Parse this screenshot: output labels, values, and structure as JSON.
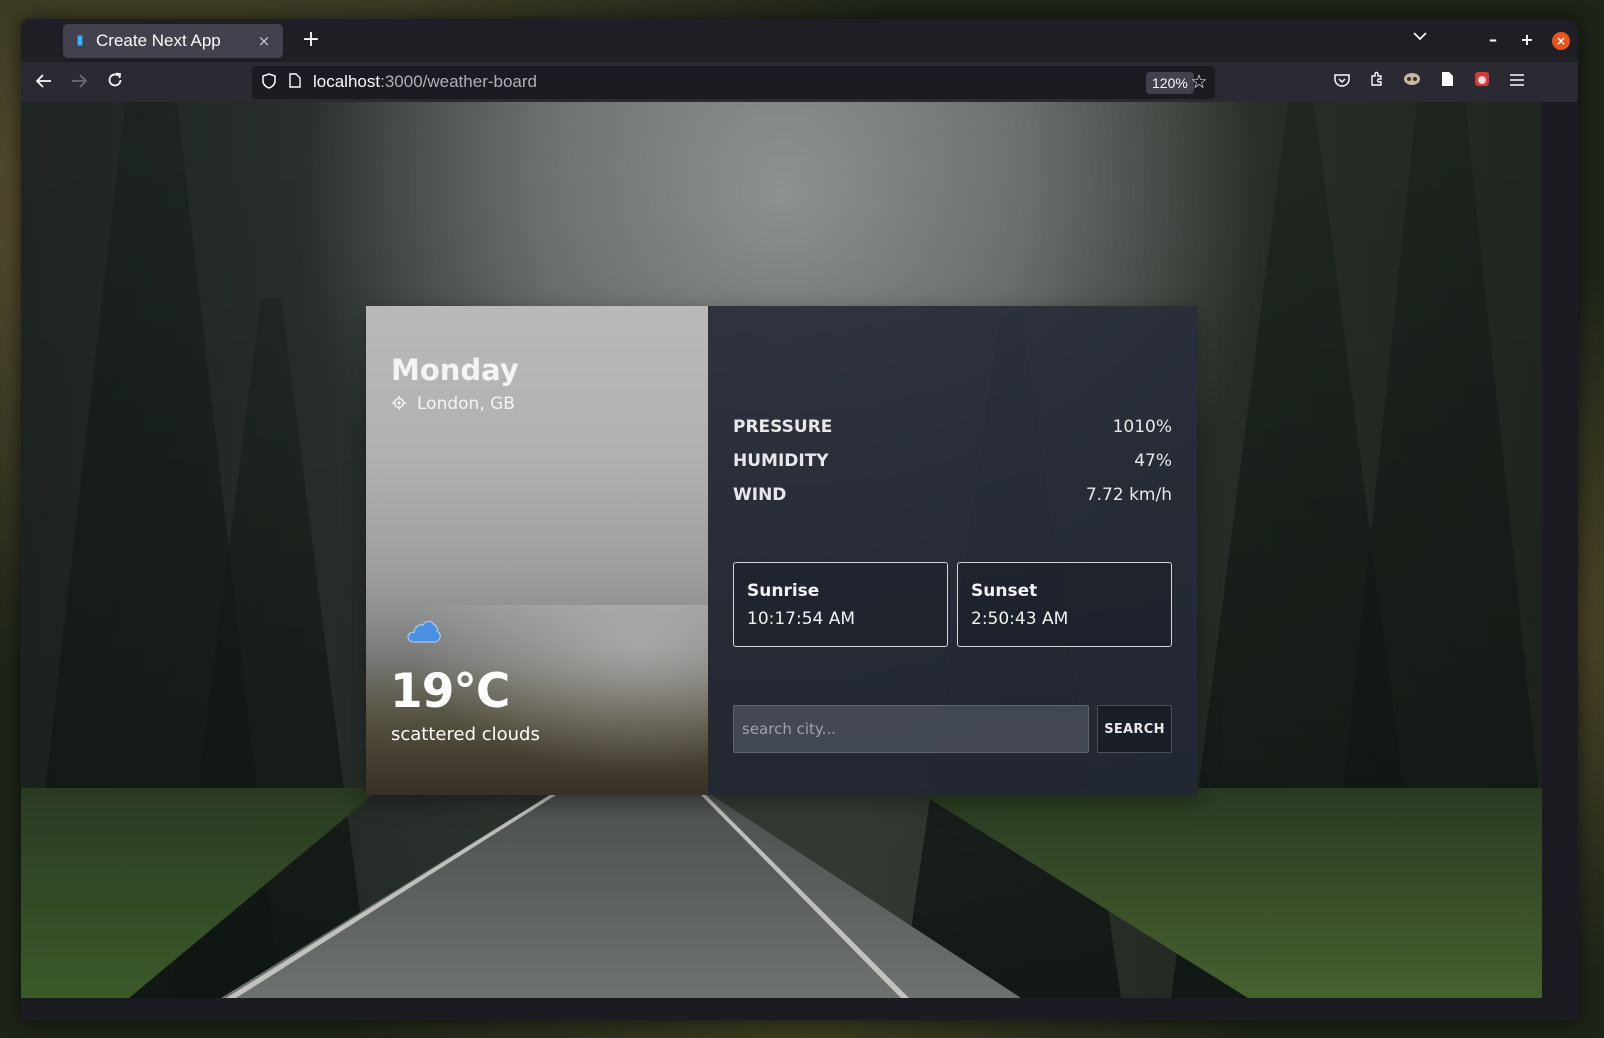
{
  "browser": {
    "tab_title": "Create Next App",
    "tab_close": "×",
    "new_tab": "+",
    "url_host": "localhost",
    "url_rest": ":3000/weather-board",
    "zoom": "120%"
  },
  "weather": {
    "day": "Monday",
    "location": "London, GB",
    "temperature": "19°C",
    "description": "scattered clouds",
    "icon": "cloud-icon",
    "stats": [
      {
        "label": "PRESSURE",
        "value": "1010%"
      },
      {
        "label": "HUMIDITY",
        "value": "47%"
      },
      {
        "label": "WIND",
        "value": "7.72 km/h"
      }
    ],
    "sunrise": {
      "label": "Sunrise",
      "time": "10:17:54 AM"
    },
    "sunset": {
      "label": "Sunset",
      "time": "2:50:43 AM"
    }
  },
  "search": {
    "placeholder": "search city...",
    "value": "",
    "button_label": "SEARCH"
  },
  "colors": {
    "window_close": "#e95420",
    "cloud_icon": "#4a90e2"
  }
}
